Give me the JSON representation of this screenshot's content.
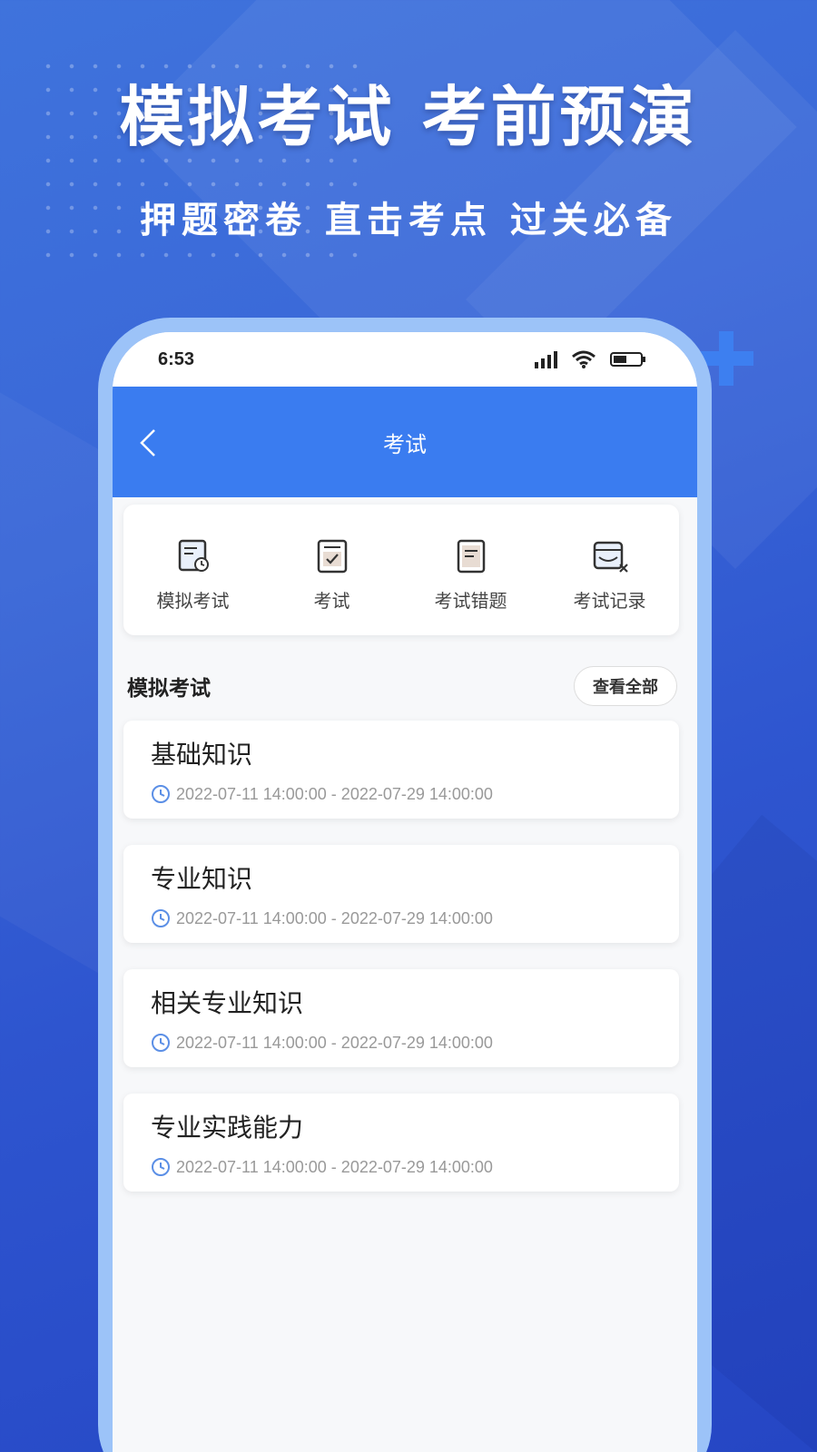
{
  "promo": {
    "headline": "模拟考试 考前预演",
    "subline": "押题密卷 直击考点 过关必备"
  },
  "status_bar": {
    "time": "6:53"
  },
  "nav": {
    "title": "考试"
  },
  "menu": [
    {
      "label": "模拟考试",
      "icon": "mock-exam-icon"
    },
    {
      "label": "考试",
      "icon": "exam-check-icon"
    },
    {
      "label": "考试错题",
      "icon": "wrong-questions-icon"
    },
    {
      "label": "考试记录",
      "icon": "exam-record-icon"
    }
  ],
  "section": {
    "title": "模拟考试",
    "view_all": "查看全部"
  },
  "exams": [
    {
      "name": "基础知识",
      "time": "2022-07-11 14:00:00 - 2022-07-29 14:00:00"
    },
    {
      "name": "专业知识",
      "time": "2022-07-11 14:00:00 - 2022-07-29 14:00:00"
    },
    {
      "name": "相关专业知识",
      "time": "2022-07-11 14:00:00 - 2022-07-29 14:00:00"
    },
    {
      "name": "专业实践能力",
      "time": "2022-07-11 14:00:00 - 2022-07-29 14:00:00"
    }
  ],
  "colors": {
    "nav_blue": "#3a7cf0",
    "background_blue": "#2e55cf",
    "phone_frame": "#9cc3f8"
  }
}
